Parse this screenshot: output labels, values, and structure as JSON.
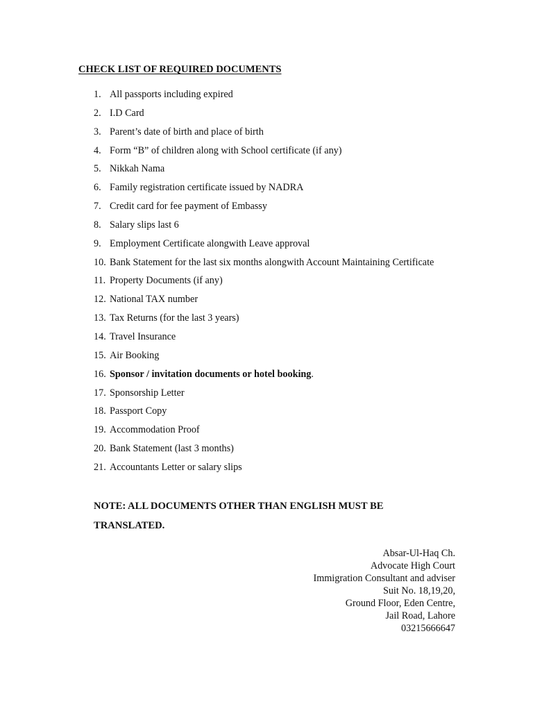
{
  "document": {
    "title": "CHECK LIST OF REQUIRED DOCUMENTS",
    "items": [
      {
        "number": "1.",
        "text": "All passports including expired",
        "bold": false,
        "suffix": ""
      },
      {
        "number": "2.",
        "text": "I.D Card",
        "bold": false,
        "suffix": ""
      },
      {
        "number": "3.",
        "text": "Parent’s date of birth and place of birth",
        "bold": false,
        "suffix": ""
      },
      {
        "number": "4.",
        "text": "Form “B” of children along with School certificate (if any)",
        "bold": false,
        "suffix": ""
      },
      {
        "number": "5.",
        "text": "Nikkah Nama",
        "bold": false,
        "suffix": ""
      },
      {
        "number": "6.",
        "text": "Family registration certificate issued by NADRA",
        "bold": false,
        "suffix": ""
      },
      {
        "number": "7.",
        "text": "Credit card for fee payment of Embassy",
        "bold": false,
        "suffix": ""
      },
      {
        "number": "8.",
        "text": "Salary slips last 6",
        "bold": false,
        "suffix": ""
      },
      {
        "number": "9.",
        "text": "Employment Certificate alongwith Leave approval",
        "bold": false,
        "suffix": ""
      },
      {
        "number": "10.",
        "text": "Bank Statement for the last six months alongwith Account Maintaining Certificate",
        "bold": false,
        "suffix": ""
      },
      {
        "number": "11.",
        "text": "Property Documents (if any)",
        "bold": false,
        "suffix": ""
      },
      {
        "number": "12.",
        "text": "National TAX number",
        "bold": false,
        "suffix": ""
      },
      {
        "number": "13.",
        "text": "Tax Returns (for the last 3 years)",
        "bold": false,
        "suffix": ""
      },
      {
        "number": "14.",
        "text": "Travel Insurance",
        "bold": false,
        "suffix": ""
      },
      {
        "number": "15.",
        "text": "Air Booking",
        "bold": false,
        "suffix": ""
      },
      {
        "number": "16.",
        "text": "Sponsor / invitation documents or hotel booking",
        "bold": true,
        "suffix": "."
      },
      {
        "number": "17.",
        "text": "Sponsorship Letter",
        "bold": false,
        "suffix": ""
      },
      {
        "number": "18.",
        "text": "Passport Copy",
        "bold": false,
        "suffix": ""
      },
      {
        "number": "19.",
        "text": "Accommodation Proof",
        "bold": false,
        "suffix": ""
      },
      {
        "number": "20.",
        "text": "Bank Statement (last 3 months)",
        "bold": false,
        "suffix": ""
      },
      {
        "number": "21.",
        "text": "Accountants Letter or salary slips",
        "bold": false,
        "suffix": ""
      }
    ],
    "note": "NOTE: ALL DOCUMENTS OTHER THAN ENGLISH MUST BE TRANSLATED.",
    "signature": [
      "Absar-Ul-Haq Ch.",
      "Advocate High Court",
      "Immigration Consultant and adviser",
      "Suit No. 18,19,20,",
      "Ground Floor, Eden Centre,",
      "Jail Road, Lahore",
      "03215666647"
    ]
  }
}
